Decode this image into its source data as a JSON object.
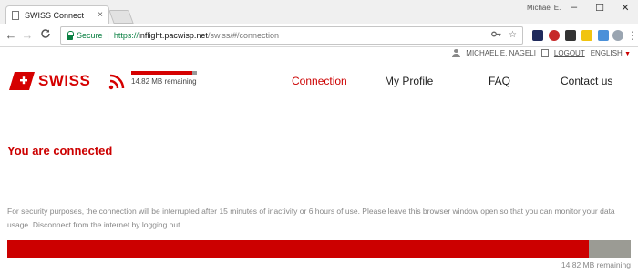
{
  "browser": {
    "tab_title": "SWISS Connect",
    "tab_close": "×",
    "window_user": "Michael E.",
    "win_minimize": "–",
    "win_maximize": "☐",
    "win_close": "✕",
    "back": "←",
    "forward": "→",
    "reload": "C",
    "secure_label": "Secure",
    "url_scheme": "https://",
    "url_host": "inflight.pacwisp.net",
    "url_path": "/swiss/#/connection",
    "key_icon": "key-icon",
    "star_icon": "☆",
    "menu_icon": "⋮"
  },
  "user": {
    "name": "MICHAEL E. NAGELI",
    "logout": "LOGOUT",
    "language": "ENGLISH",
    "language_caret": "▼"
  },
  "brand": {
    "name": "SWISS",
    "color": "#d50000"
  },
  "quota": {
    "label": "14.82 MB remaining",
    "remaining_fraction": 0.93
  },
  "nav": {
    "items": [
      {
        "label": "Connection",
        "active": true
      },
      {
        "label": "My Profile",
        "active": false
      },
      {
        "label": "FAQ",
        "active": false
      },
      {
        "label": "Contact us",
        "active": false
      }
    ]
  },
  "main": {
    "status_title": "You are connected",
    "info_text": "For security purposes, the connection will be interrupted after 15 minutes of inactivity or 6 hours of use. Please leave this browser window open so that you can monitor your data usage. Disconnect from the internet by logging out.",
    "usage_label": "14.82 MB remaining",
    "usage_fraction": 0.933
  }
}
